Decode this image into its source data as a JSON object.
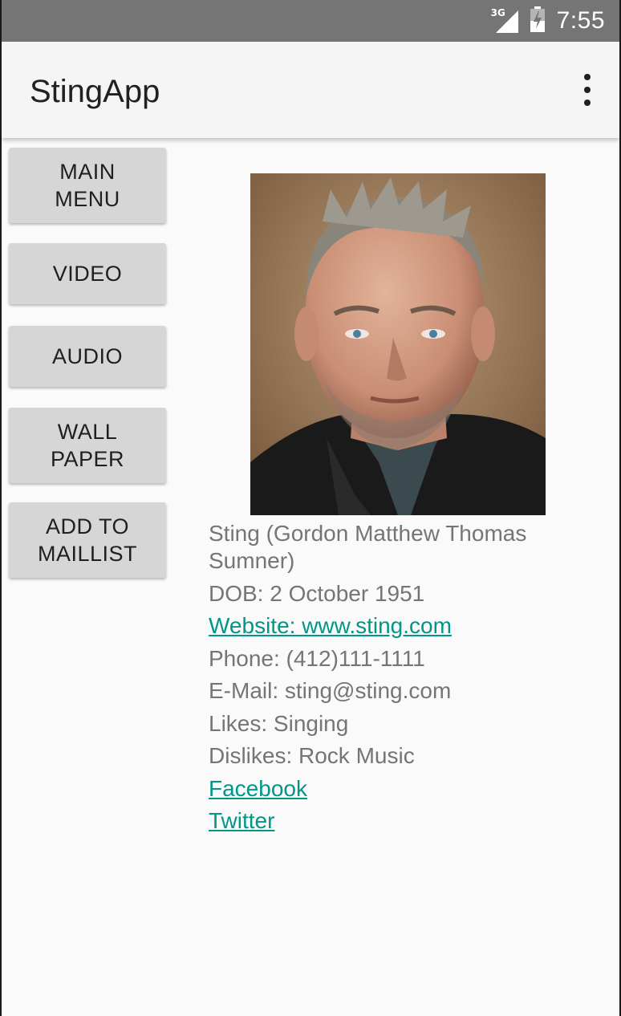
{
  "status_bar": {
    "network_type": "3G",
    "time": "7:55",
    "icons": [
      "signal-icon",
      "battery-icon"
    ]
  },
  "app_bar": {
    "title": "StingApp",
    "overflow_icon": "more-vert-icon"
  },
  "side_menu": {
    "buttons": [
      {
        "label": "MAIN\nMENU"
      },
      {
        "label": "VIDEO"
      },
      {
        "label": "AUDIO"
      },
      {
        "label": "WALL\nPAPER"
      },
      {
        "label": "ADD TO\nMAILLIST"
      }
    ]
  },
  "profile": {
    "photo_alt": "portrait-photo",
    "name": "Sting (Gordon Matthew Thomas Sumner)",
    "dob": "DOB: 2 October 1951",
    "website": "Website: www.sting.com",
    "phone": "Phone: (412)111-1111",
    "email": "E-Mail: sting@sting.com",
    "likes": "Likes: Singing",
    "dislikes": "Dislikes: Rock Music",
    "facebook": "Facebook",
    "twitter": "Twitter"
  },
  "colors": {
    "status_bar": "#757575",
    "app_bar": "#f5f5f5",
    "button": "#d6d6d6",
    "link": "#009688",
    "body_text": "#757575"
  }
}
